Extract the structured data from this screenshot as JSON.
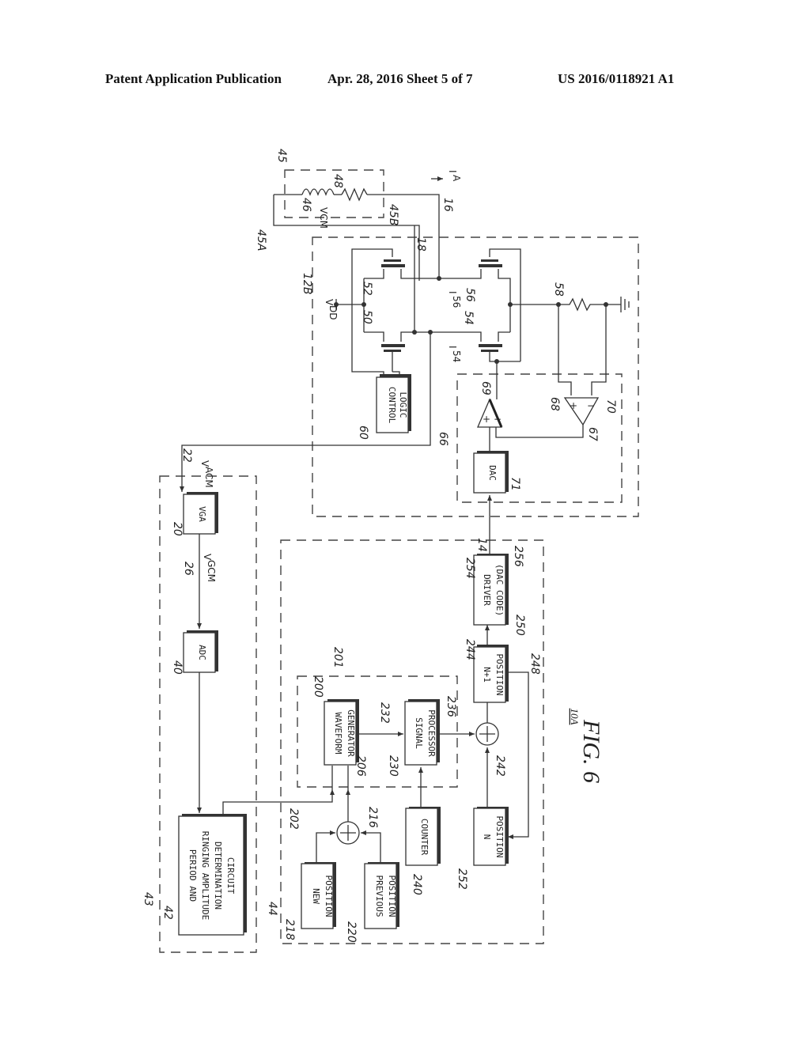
{
  "header": {
    "left": "Patent Application Publication",
    "middle": "Apr. 28, 2016  Sheet 5 of 7",
    "right": "US 2016/0118921 A1"
  },
  "figure": {
    "title": "FIG. 6",
    "ref": "10A"
  },
  "blocks": {
    "period_circuit": [
      "PERIOD AND",
      "RINGING AMPLITUDE",
      "DETERMINATION",
      "CIRCUIT"
    ],
    "new_position": [
      "NEW",
      "POSITION"
    ],
    "previous_position": [
      "PREVIOUS",
      "POSITION"
    ],
    "counter": [
      "COUNTER"
    ],
    "n_position": [
      "N",
      "POSITION"
    ],
    "waveform_generator": [
      "WAVEFORM",
      "GENERATOR"
    ],
    "signal_processor": [
      "SIGNAL",
      "PROCESSOR"
    ],
    "n1_position": [
      "N+1",
      "POSITION"
    ],
    "driver": [
      "DRIVER",
      "(DAC CODE)"
    ],
    "adc": [
      "ADC"
    ],
    "vga": [
      "VGA"
    ],
    "dac": [
      "DAC"
    ],
    "control_logic": [
      "CONTROL",
      "LOGIC"
    ]
  },
  "symbols": {
    "vacm": "V",
    "vacm_sub": "ACM",
    "vgcm": "V",
    "vgcm_sub": "GCM",
    "vdd": "V",
    "vdd_sub": "DD",
    "vcm": "VCM",
    "ia": "I",
    "ia_sub": "A",
    "i56": "I",
    "i56_sub": "56",
    "i54": "I",
    "i54_sub": "54",
    "plus": "+",
    "minus": "−"
  },
  "refs": {
    "r45": "45",
    "r45A": "45A",
    "r45B": "45B",
    "r46": "46",
    "r48": "48",
    "r16": "16",
    "r18": "18",
    "r12B": "12B",
    "r50": "50",
    "r52": "52",
    "r54": "54",
    "r56": "56",
    "r58": "58",
    "r60": "60",
    "r66": "66",
    "r67": "67",
    "r68": "68",
    "r69": "69",
    "r70": "70",
    "r71": "71",
    "r22": "22",
    "r20": "20",
    "r26": "26",
    "r40": "40",
    "r42": "42",
    "r43": "43",
    "r44": "44",
    "r14": "14",
    "r254": "254",
    "r256": "256",
    "r250": "250",
    "r244": "244",
    "r248": "248",
    "r201": "201",
    "r200": "200",
    "r232": "232",
    "r206": "206",
    "r236": "236",
    "r230": "230",
    "r242": "242",
    "r202": "202",
    "r216": "216",
    "r218": "218",
    "r220": "220",
    "r240": "240",
    "r252": "252"
  }
}
